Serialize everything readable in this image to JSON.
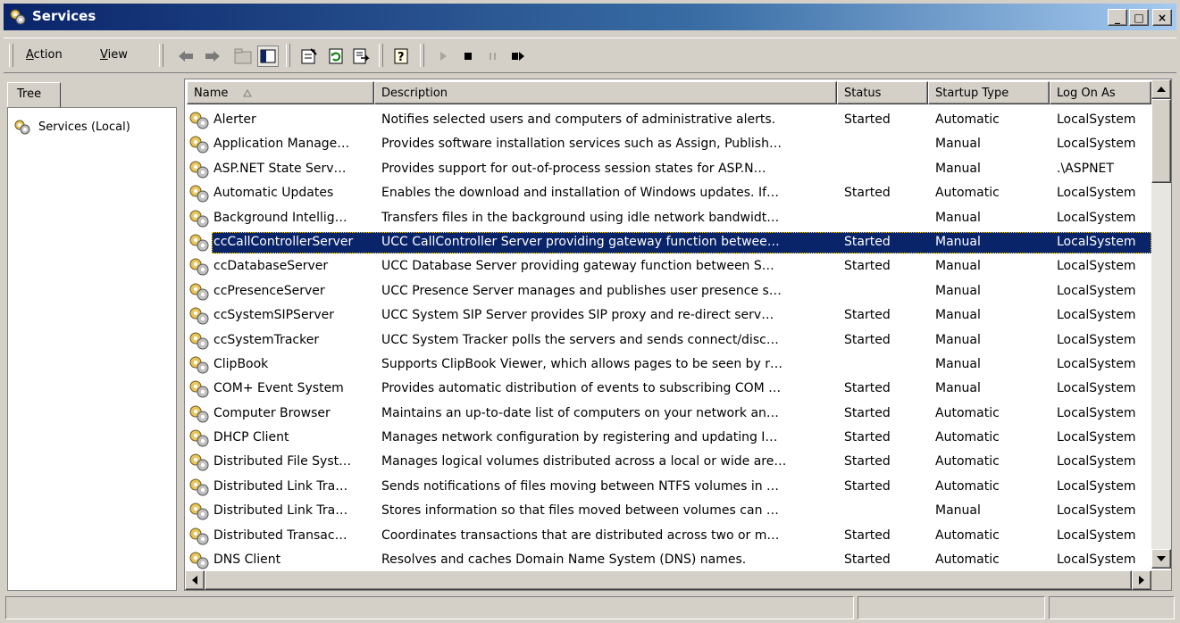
{
  "window": {
    "title": "Services",
    "app_icon": "gears-icon",
    "controls": {
      "minimize": "_",
      "maximize": "□",
      "close": "×"
    }
  },
  "toolbar": {
    "menu": [
      {
        "label": "Action",
        "accel": "A"
      },
      {
        "label": "View",
        "accel": "V"
      }
    ],
    "buttons": [
      {
        "name": "back-arrow-icon",
        "enabled": true
      },
      {
        "name": "forward-arrow-icon",
        "enabled": true
      },
      {
        "name": "up-folder-icon",
        "enabled": false
      },
      {
        "name": "show-hide-tree-icon",
        "enabled": true
      },
      {
        "name": "properties-icon",
        "enabled": true
      },
      {
        "name": "refresh-icon",
        "enabled": true
      },
      {
        "name": "export-list-icon",
        "enabled": true
      },
      {
        "name": "help-icon",
        "enabled": true
      },
      {
        "name": "start-service-icon",
        "enabled": false
      },
      {
        "name": "stop-service-icon",
        "enabled": true
      },
      {
        "name": "pause-service-icon",
        "enabled": false
      },
      {
        "name": "restart-service-icon",
        "enabled": true
      }
    ]
  },
  "tree": {
    "tab_label": "Tree",
    "node_label": "Services (Local)"
  },
  "list": {
    "columns": [
      "Name",
      "Description",
      "Status",
      "Startup Type",
      "Log On As"
    ],
    "sort_column": "Name",
    "sort_direction": "ascending",
    "selected_index": 5,
    "rows": [
      {
        "name": "Alerter",
        "description": "Notifies selected users and computers of administrative alerts.",
        "status": "Started",
        "startup": "Automatic",
        "logon": "LocalSystem"
      },
      {
        "name": "Application Manage…",
        "description": "Provides software installation services such as Assign, Publish…",
        "status": "",
        "startup": "Manual",
        "logon": "LocalSystem"
      },
      {
        "name": "ASP.NET State Serv…",
        "description": "Provides support for out-of-process session states for ASP.N…",
        "status": "",
        "startup": "Manual",
        "logon": ".\\ASPNET"
      },
      {
        "name": "Automatic Updates",
        "description": "Enables the download and installation of Windows updates. If…",
        "status": "Started",
        "startup": "Automatic",
        "logon": "LocalSystem"
      },
      {
        "name": "Background Intellig…",
        "description": "Transfers files in the background using idle network bandwidt…",
        "status": "",
        "startup": "Manual",
        "logon": "LocalSystem"
      },
      {
        "name": "ccCallControllerServer",
        "description": "UCC CallController Server providing gateway function betwee…",
        "status": "Started",
        "startup": "Manual",
        "logon": "LocalSystem"
      },
      {
        "name": "ccDatabaseServer",
        "description": "UCC Database Server providing gateway function between S…",
        "status": "Started",
        "startup": "Manual",
        "logon": "LocalSystem"
      },
      {
        "name": "ccPresenceServer",
        "description": "UCC Presence Server manages and publishes user presence s…",
        "status": "",
        "startup": "Manual",
        "logon": "LocalSystem"
      },
      {
        "name": "ccSystemSIPServer",
        "description": "UCC System SIP Server provides SIP proxy and re-direct serv…",
        "status": "Started",
        "startup": "Manual",
        "logon": "LocalSystem"
      },
      {
        "name": "ccSystemTracker",
        "description": "UCC System Tracker polls the servers and sends connect/disc…",
        "status": "Started",
        "startup": "Manual",
        "logon": "LocalSystem"
      },
      {
        "name": "ClipBook",
        "description": "Supports ClipBook Viewer, which allows pages to be seen by r…",
        "status": "",
        "startup": "Manual",
        "logon": "LocalSystem"
      },
      {
        "name": "COM+ Event System",
        "description": "Provides automatic distribution of events to subscribing COM …",
        "status": "Started",
        "startup": "Manual",
        "logon": "LocalSystem"
      },
      {
        "name": "Computer Browser",
        "description": "Maintains an up-to-date list of computers on your network an…",
        "status": "Started",
        "startup": "Automatic",
        "logon": "LocalSystem"
      },
      {
        "name": "DHCP Client",
        "description": "Manages network configuration by registering and updating I…",
        "status": "Started",
        "startup": "Automatic",
        "logon": "LocalSystem"
      },
      {
        "name": "Distributed File Syst…",
        "description": "Manages logical volumes distributed across a local or wide are…",
        "status": "Started",
        "startup": "Automatic",
        "logon": "LocalSystem"
      },
      {
        "name": "Distributed Link Tra…",
        "description": "Sends notifications of files moving between NTFS volumes in …",
        "status": "Started",
        "startup": "Automatic",
        "logon": "LocalSystem"
      },
      {
        "name": "Distributed Link Tra…",
        "description": "Stores information so that files moved between volumes can …",
        "status": "",
        "startup": "Manual",
        "logon": "LocalSystem"
      },
      {
        "name": "Distributed Transac…",
        "description": "Coordinates transactions that are distributed across two or m…",
        "status": "Started",
        "startup": "Automatic",
        "logon": "LocalSystem"
      },
      {
        "name": "DNS Client",
        "description": "Resolves and caches Domain Name System (DNS) names.",
        "status": "Started",
        "startup": "Automatic",
        "logon": "LocalSystem"
      }
    ]
  },
  "colors": {
    "title_gradient_start": "#0a246a",
    "title_gradient_end": "#a6caf0",
    "selection": "#0a246a",
    "face": "#d4d0c8"
  }
}
